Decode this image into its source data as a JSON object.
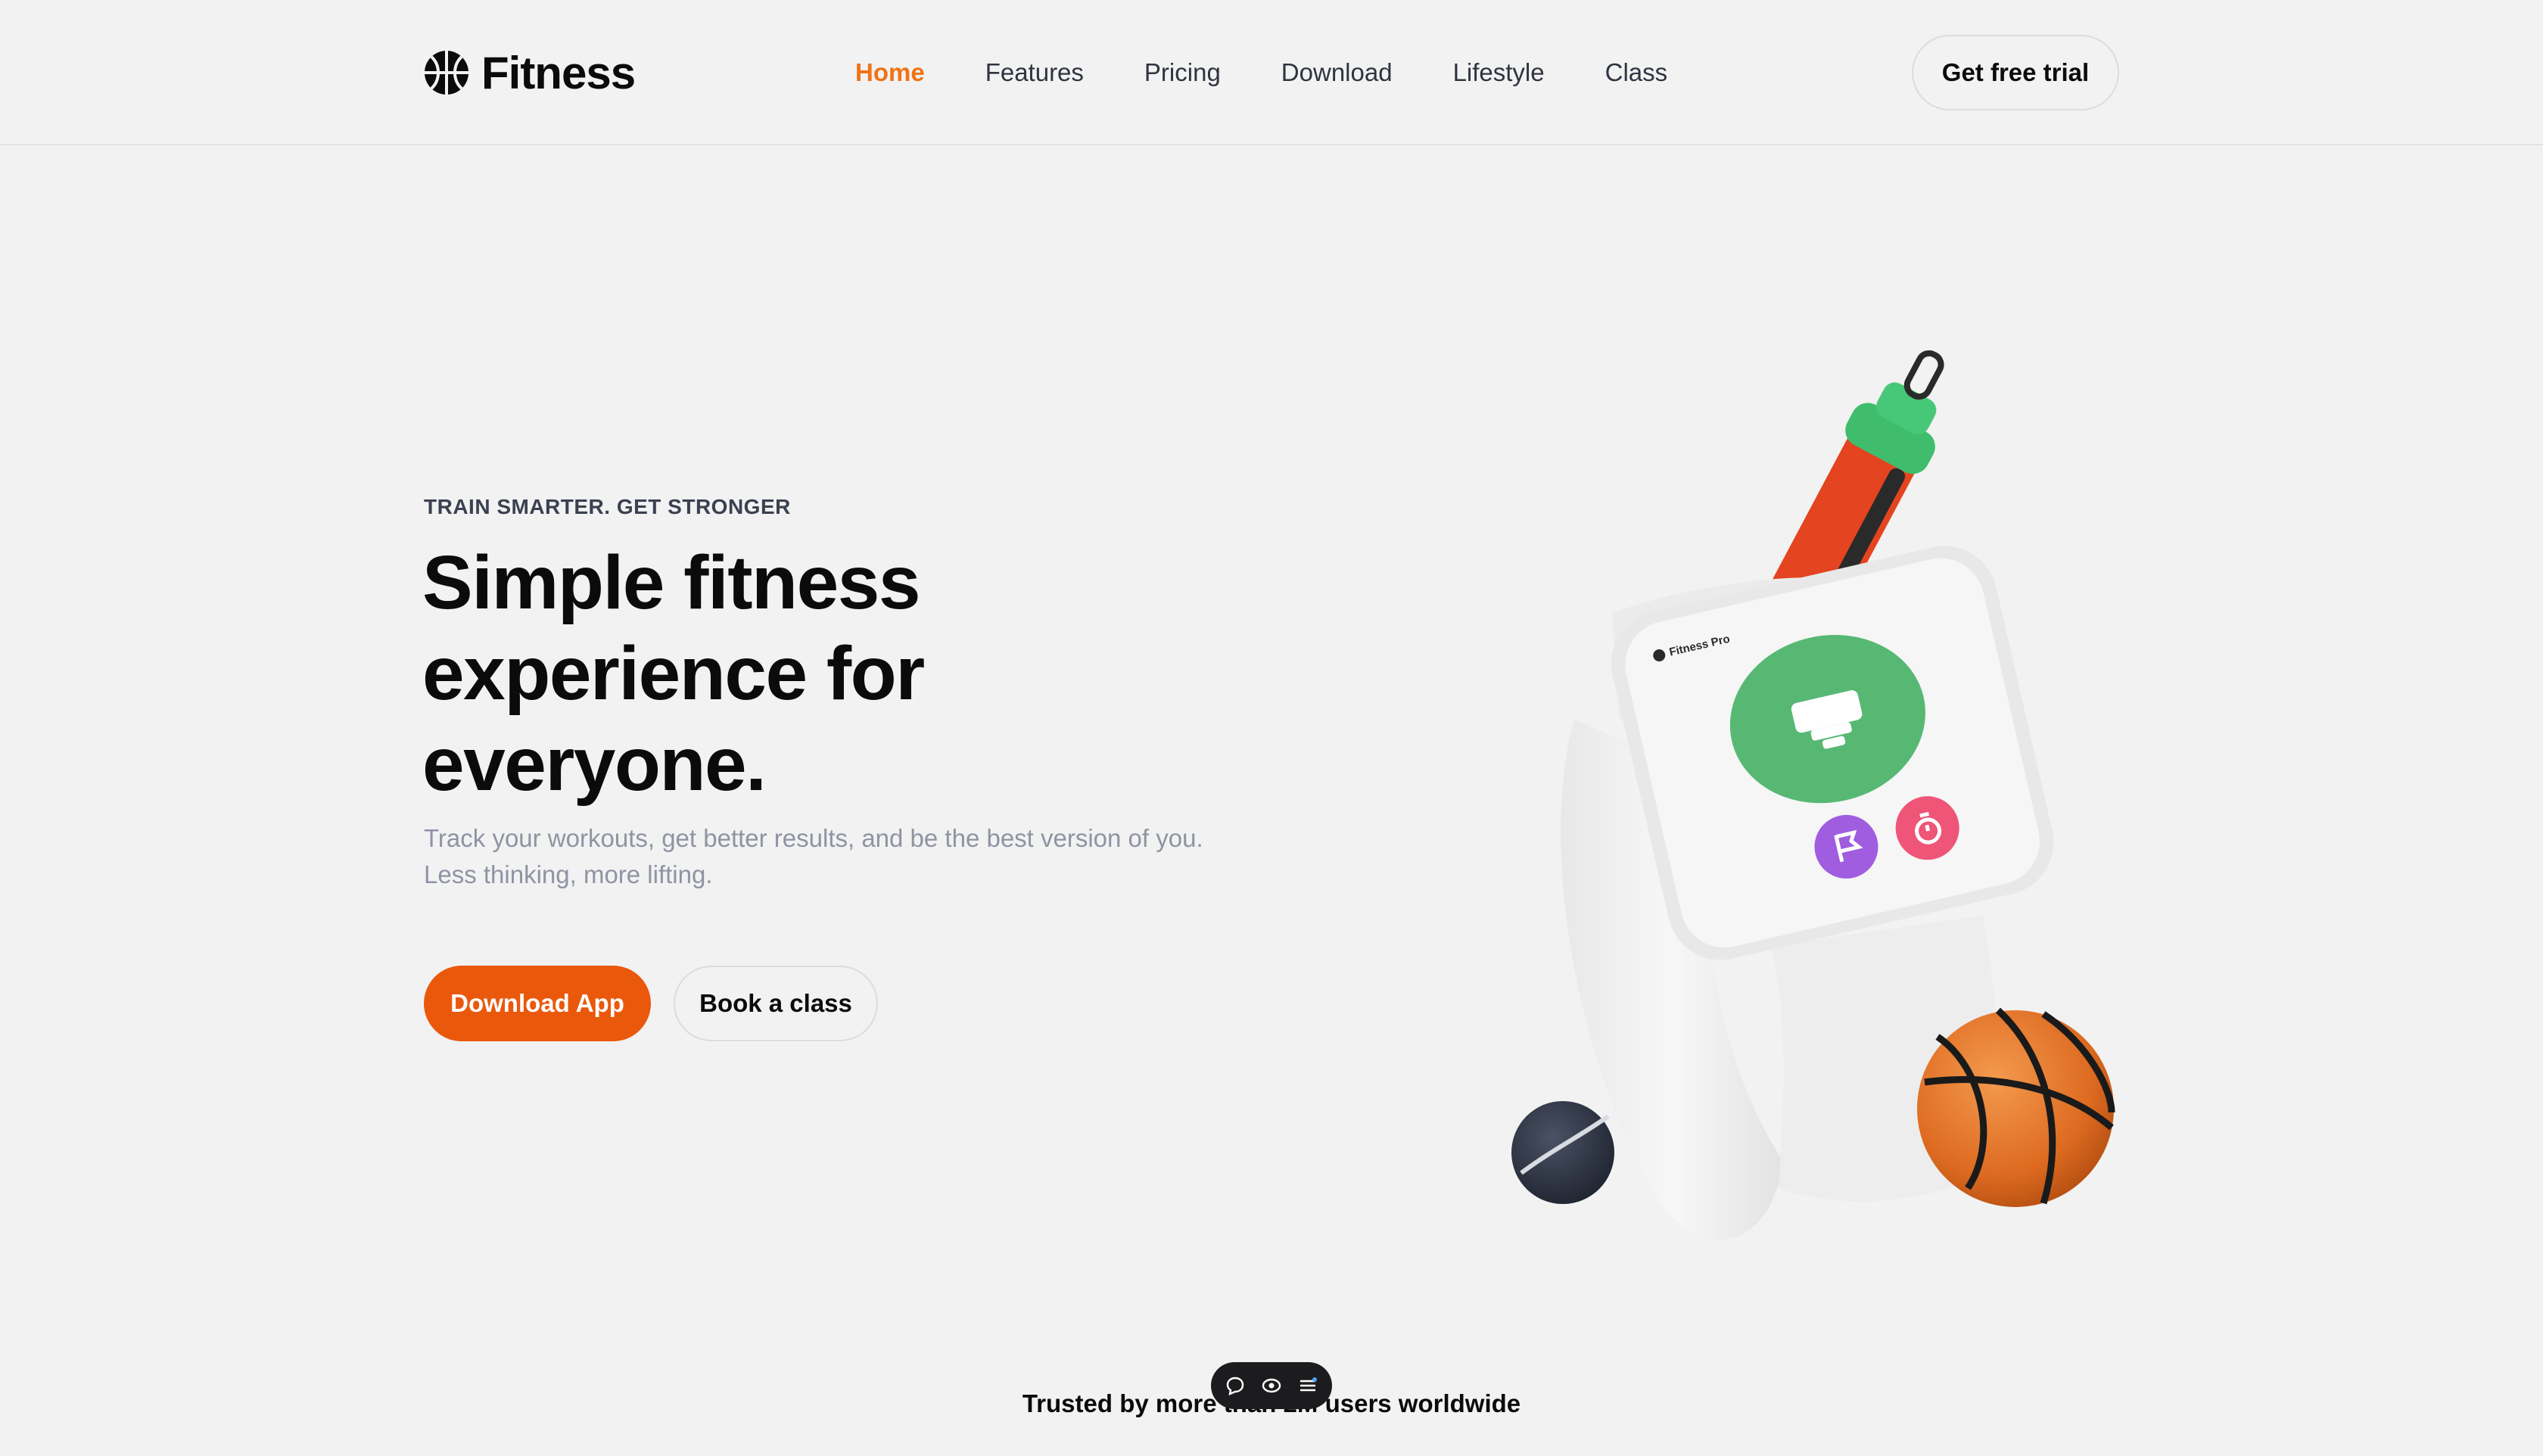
{
  "brand": {
    "name": "Fitness",
    "icon": "basketball-logo-icon"
  },
  "nav": {
    "items": [
      {
        "label": "Home",
        "active": true
      },
      {
        "label": "Features",
        "active": false
      },
      {
        "label": "Pricing",
        "active": false
      },
      {
        "label": "Download",
        "active": false
      },
      {
        "label": "Lifestyle",
        "active": false
      },
      {
        "label": "Class",
        "active": false
      }
    ],
    "active_color": "#f07316"
  },
  "header": {
    "cta_label": "Get free trial"
  },
  "hero": {
    "eyebrow": "TRAIN SMARTER. GET STRONGER",
    "title_lines": [
      "Simple fitness",
      "experience for",
      "everyone."
    ],
    "subtitle_lines": [
      "Track your workouts, get better results, and be the best version of you.",
      "Less thinking, more lifting."
    ],
    "primary_button": "Download App",
    "secondary_button": "Book a class"
  },
  "illustration": {
    "watch_app_label": "Fitness Pro",
    "icons": [
      "shaker-bottle",
      "smartwatch",
      "tennis-ball",
      "basketball",
      "flag-icon",
      "timer-icon"
    ]
  },
  "footer": {
    "trusted_text": "Trusted by more than 2M users worldwide"
  },
  "toolbar": {
    "icons": [
      "comment-icon",
      "eye-icon",
      "list-icon"
    ]
  },
  "colors": {
    "background": "#f2f2f2",
    "accent": "#ea580c",
    "watch_green": "#57b874",
    "watch_purple": "#a05de0",
    "watch_pink": "#ee5577"
  }
}
